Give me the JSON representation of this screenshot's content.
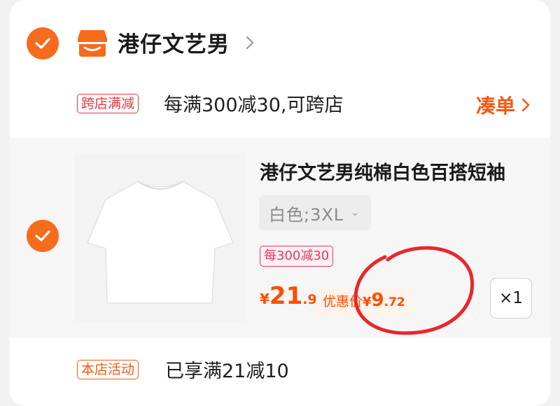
{
  "shop": {
    "name": "港仔文艺男"
  },
  "promo": {
    "tag": "跨店满减",
    "text": "每满300减30,可跨店",
    "action": "凑单"
  },
  "item": {
    "title": "港仔文艺男纯棉白色百搭短袖",
    "sku": "白色;3XL",
    "discount_tag": "每300减30",
    "price": {
      "currency": "¥",
      "integer": "21",
      "decimal": ".9"
    },
    "promo_price": {
      "label": "优惠价",
      "currency": "¥",
      "integer": "9",
      "decimal": ".72"
    },
    "quantity": "×1"
  },
  "activity": {
    "tag": "本店活动",
    "text": "已享满21减10"
  },
  "colors": {
    "accent": "#f76b1c",
    "price": "#ff4d00",
    "promo_tag": "#e8363d",
    "annotation": "#e8272b"
  },
  "icons": [
    "check-icon",
    "shop-logo-icon",
    "chevron-right-icon",
    "chevron-down-icon"
  ]
}
